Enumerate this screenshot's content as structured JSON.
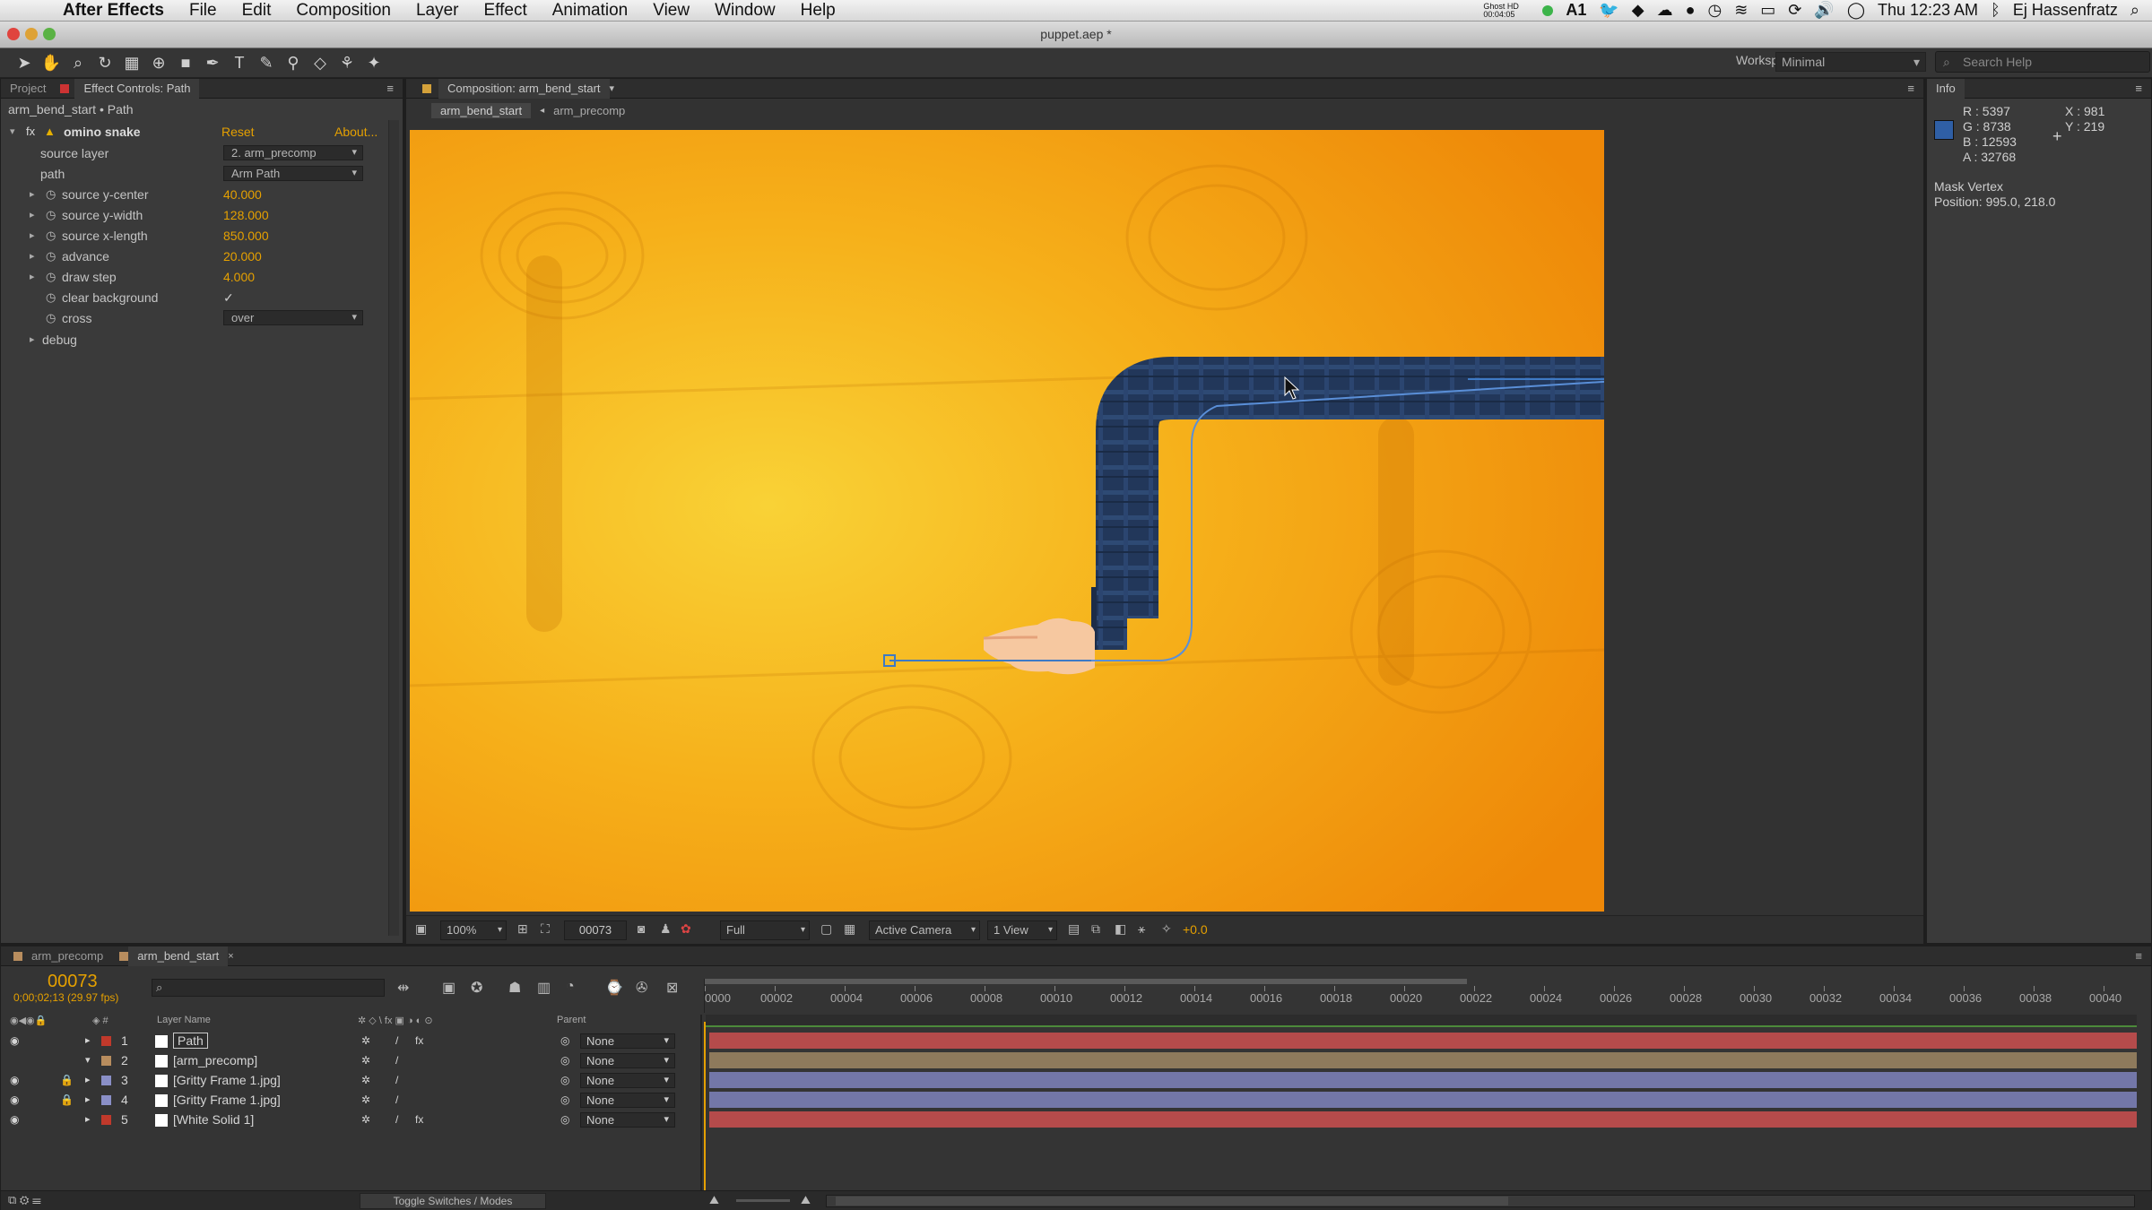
{
  "menubar": {
    "app": "After Effects",
    "items": [
      "File",
      "Edit",
      "Composition",
      "Layer",
      "Effect",
      "Animation",
      "View",
      "Window",
      "Help"
    ],
    "status_small": "Ghost HD 00:04:05",
    "time": "Thu 12:23 AM",
    "user": "Ej Hassenfratz",
    "badge": "1"
  },
  "window": {
    "title": "puppet.aep *"
  },
  "toolbar": {
    "workspace_label": "Workspace:",
    "workspace_value": "Minimal",
    "search_placeholder": "Search Help"
  },
  "left_panel": {
    "tabs": [
      "Project",
      "Effect Controls: Path"
    ],
    "subtitle": "arm_bend_start • Path",
    "effect": {
      "name": "omino snake",
      "reset": "Reset",
      "about": "About..."
    },
    "props": [
      {
        "label": "source layer",
        "type": "dropdown",
        "value": "2. arm_precomp"
      },
      {
        "label": "path",
        "type": "dropdown",
        "value": "Arm Path"
      },
      {
        "label": "source y-center",
        "type": "number",
        "value": "40.000"
      },
      {
        "label": "source y-width",
        "type": "number",
        "value": "128.000"
      },
      {
        "label": "source x-length",
        "type": "number",
        "value": "850.000"
      },
      {
        "label": "advance",
        "type": "number",
        "value": "20.000"
      },
      {
        "label": "draw step",
        "type": "number",
        "value": "4.000"
      },
      {
        "label": "clear background",
        "type": "checkbox",
        "value": "✓"
      },
      {
        "label": "cross",
        "type": "dropdown",
        "value": "over"
      },
      {
        "label": "debug",
        "type": "group",
        "value": ""
      }
    ]
  },
  "comp_panel": {
    "tab": "Composition: arm_bend_start",
    "crumbs": [
      "arm_bend_start",
      "arm_precomp"
    ],
    "footer": {
      "zoom": "100%",
      "frame": "00073",
      "resolution": "Full",
      "camera": "Active Camera",
      "views": "1 View",
      "exposure": "+0.0"
    }
  },
  "info_panel": {
    "tab": "Info",
    "r": "R : 5397",
    "g": "G : 8738",
    "b": "B : 12593",
    "a": "A : 32768",
    "x": "X : 981",
    "y": "Y : 219",
    "mask_title": "Mask Vertex",
    "mask_pos": "Position: 995.0, 218.0",
    "swatch_color": "#2f5fa5"
  },
  "timeline": {
    "tabs": [
      "arm_precomp",
      "arm_bend_start"
    ],
    "current_frame": "00073",
    "timecode": "0;00;02;13 (29.97 fps)",
    "search_placeholder": "",
    "col_headers": {
      "name": "Layer Name",
      "parent": "Parent"
    },
    "ticks": [
      "0000",
      "00002",
      "00004",
      "00006",
      "00008",
      "00010",
      "00012",
      "00014",
      "00016",
      "00018",
      "00020",
      "00022",
      "00024",
      "00026",
      "00028",
      "00030",
      "00032",
      "00034",
      "00036",
      "00038",
      "00040"
    ],
    "layers": [
      {
        "num": "1",
        "name": "Path",
        "parent": "None",
        "label_color": "#c0392b",
        "bar_color": "#b54b4b",
        "fx": "fx"
      },
      {
        "num": "2",
        "name": "[arm_precomp]",
        "parent": "None",
        "label_color": "#b88d5e",
        "bar_color": "#8e7a5c",
        "fx": ""
      },
      {
        "num": "3",
        "name": "[Gritty Frame 1.jpg]",
        "parent": "None",
        "label_color": "#8a8fc7",
        "bar_color": "#7377a8",
        "fx": ""
      },
      {
        "num": "4",
        "name": "[Gritty Frame 1.jpg]",
        "parent": "None",
        "label_color": "#8a8fc7",
        "bar_color": "#7377a8",
        "fx": ""
      },
      {
        "num": "5",
        "name": "[White Solid 1]",
        "parent": "None",
        "label_color": "#c0392b",
        "bar_color": "#b54b4b",
        "fx": "fx"
      }
    ],
    "toggle": "Toggle Switches / Modes"
  }
}
